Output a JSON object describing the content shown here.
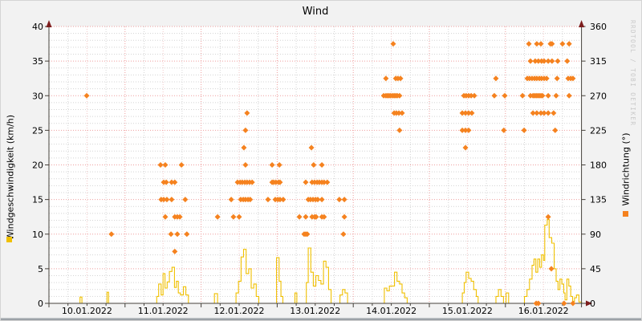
{
  "chart_data": {
    "type": "mixed",
    "title": "Wind",
    "watermark": "RRDTOOL / TOBI OETIKER",
    "x_axis": {
      "hours_total": 168,
      "minor_step_hours": 6,
      "major_step_hours": 24,
      "day_labels": [
        "10.01.2022",
        "11.01.2022",
        "12.01.2022",
        "13.01.2022",
        "14.01.2022",
        "15.01.2022",
        "16.01.2022"
      ]
    },
    "y_left": {
      "label": "Windgeschwindigkeit (km/h)",
      "min": 0,
      "max": 40,
      "tick_step": 5,
      "ticks": [
        0,
        5,
        10,
        15,
        20,
        25,
        30,
        35,
        40
      ]
    },
    "y_right": {
      "label": "Windrichtung (°)",
      "min": 0,
      "max": 360,
      "tick_step": 45,
      "ticks": [
        0,
        45,
        90,
        135,
        180,
        225,
        270,
        315,
        360
      ]
    },
    "grid": {
      "minor_h_step": 1,
      "minor_v_step_hours": 6,
      "legend_position": "axis-labels"
    },
    "colors": {
      "speed": "#f0c000",
      "direction": "#f5821f",
      "grid_minor": "#d4d4d4",
      "grid_major": "#ef9e9e",
      "grid_noon": "#f2c6c6",
      "axis": "#44403a",
      "arrow": "#7d1d1d",
      "plot_bg": "#ffffff",
      "outer_bg": "#f2f2f2"
    },
    "series": [
      {
        "name": "Windgeschwindigkeit",
        "unit": "km/h",
        "type": "step",
        "axis": "left",
        "color": "#f0c000",
        "points": [
          [
            0,
            0
          ],
          [
            9.8,
            0.9
          ],
          [
            10.4,
            0
          ],
          [
            18.3,
            1.6
          ],
          [
            18.8,
            0
          ],
          [
            34.0,
            1.0
          ],
          [
            34.6,
            2.8
          ],
          [
            35.4,
            1.2
          ],
          [
            36.0,
            4.3
          ],
          [
            36.6,
            2.2
          ],
          [
            37.3,
            3.1
          ],
          [
            38.0,
            4.6
          ],
          [
            38.8,
            5.2
          ],
          [
            39.6,
            2.3
          ],
          [
            40.2,
            3.2
          ],
          [
            40.8,
            1.5
          ],
          [
            41.5,
            1.2
          ],
          [
            42.4,
            2.4
          ],
          [
            43.2,
            1.2
          ],
          [
            44.0,
            0
          ],
          [
            52.2,
            1.4
          ],
          [
            53.2,
            0
          ],
          [
            59.0,
            1.5
          ],
          [
            59.8,
            3.2
          ],
          [
            60.6,
            6.7
          ],
          [
            61.4,
            7.8
          ],
          [
            62.2,
            4.3
          ],
          [
            63.0,
            5.0
          ],
          [
            63.8,
            2.2
          ],
          [
            64.6,
            2.8
          ],
          [
            65.4,
            1.0
          ],
          [
            66.2,
            0
          ],
          [
            71.8,
            6.6
          ],
          [
            72.6,
            3.2
          ],
          [
            73.2,
            1.0
          ],
          [
            73.8,
            0
          ],
          [
            77.6,
            1.5
          ],
          [
            78.2,
            0
          ],
          [
            81.2,
            3.0
          ],
          [
            81.8,
            8.0
          ],
          [
            82.6,
            4.5
          ],
          [
            83.4,
            2.5
          ],
          [
            84.2,
            4.0
          ],
          [
            85.0,
            3.3
          ],
          [
            85.8,
            2.8
          ],
          [
            86.6,
            6.1
          ],
          [
            87.4,
            5.2
          ],
          [
            88.2,
            2.0
          ],
          [
            89.0,
            0
          ],
          [
            91.8,
            1.2
          ],
          [
            92.6,
            2.0
          ],
          [
            93.4,
            1.5
          ],
          [
            94.2,
            0
          ],
          [
            105.8,
            2.2
          ],
          [
            106.6,
            1.8
          ],
          [
            107.4,
            2.5
          ],
          [
            109.0,
            4.5
          ],
          [
            109.8,
            3.2
          ],
          [
            110.6,
            2.8
          ],
          [
            111.4,
            1.5
          ],
          [
            112.2,
            0.8
          ],
          [
            113.0,
            0
          ],
          [
            130.4,
            1.5
          ],
          [
            131.0,
            3.0
          ],
          [
            131.6,
            4.5
          ],
          [
            132.4,
            3.6
          ],
          [
            133.2,
            3.2
          ],
          [
            134.0,
            2.0
          ],
          [
            134.8,
            1.0
          ],
          [
            135.4,
            0
          ],
          [
            141.0,
            1.0
          ],
          [
            141.8,
            2.0
          ],
          [
            142.6,
            1.0
          ],
          [
            143.4,
            0
          ],
          [
            144.2,
            1.5
          ],
          [
            145.0,
            0
          ],
          [
            150.0,
            1.0
          ],
          [
            150.8,
            2.0
          ],
          [
            151.6,
            3.5
          ],
          [
            152.4,
            5.5
          ],
          [
            153.0,
            6.4
          ],
          [
            153.6,
            4.5
          ],
          [
            154.2,
            6.4
          ],
          [
            154.8,
            5.2
          ],
          [
            155.4,
            7.0
          ],
          [
            156.0,
            6.2
          ],
          [
            156.4,
            11.3
          ],
          [
            157.2,
            12.1
          ],
          [
            157.8,
            9.5
          ],
          [
            158.6,
            8.7
          ],
          [
            159.4,
            5.0
          ],
          [
            160.0,
            3.2
          ],
          [
            160.6,
            2.0
          ],
          [
            161.2,
            3.5
          ],
          [
            161.8,
            2.8
          ],
          [
            162.4,
            1.5
          ],
          [
            162.8,
            0.5
          ],
          [
            163.4,
            3.5
          ],
          [
            164.0,
            2.5
          ],
          [
            164.6,
            1.0
          ],
          [
            165.2,
            0.3
          ],
          [
            165.8,
            0.8
          ],
          [
            166.4,
            1.2
          ],
          [
            167.2,
            0.2
          ],
          [
            168,
            0
          ]
        ]
      },
      {
        "name": "Windrichtung",
        "unit": "°",
        "type": "scatter",
        "marker": "diamond",
        "axis": "right",
        "color": "#f5821f",
        "points": [
          [
            11.9,
            270
          ],
          [
            19.7,
            90
          ],
          [
            35.2,
            180
          ],
          [
            35.4,
            135
          ],
          [
            36.2,
            157.5
          ],
          [
            36.2,
            135
          ],
          [
            36.7,
            180
          ],
          [
            36.7,
            112.5
          ],
          [
            37.0,
            157.5
          ],
          [
            37.2,
            135
          ],
          [
            38.5,
            90
          ],
          [
            38.7,
            157.5
          ],
          [
            38.7,
            135
          ],
          [
            39.7,
            157.5
          ],
          [
            39.7,
            112.5
          ],
          [
            39.7,
            67.5
          ],
          [
            40.5,
            112.5
          ],
          [
            40.5,
            90
          ],
          [
            41.3,
            112.5
          ],
          [
            41.8,
            180
          ],
          [
            43.0,
            135
          ],
          [
            43.5,
            90
          ],
          [
            53.2,
            112.5
          ],
          [
            57.5,
            135
          ],
          [
            58.2,
            112.5
          ],
          [
            59.5,
            157.5
          ],
          [
            60.0,
            112.5
          ],
          [
            60.3,
            157.5
          ],
          [
            60.5,
            135
          ],
          [
            61.0,
            157.5
          ],
          [
            61.3,
            135
          ],
          [
            61.5,
            202.5
          ],
          [
            61.8,
            157.5
          ],
          [
            62.0,
            225
          ],
          [
            62.0,
            180
          ],
          [
            62.0,
            135
          ],
          [
            62.5,
            247.5
          ],
          [
            62.5,
            157.5
          ],
          [
            62.8,
            135
          ],
          [
            63.3,
            157.5
          ],
          [
            63.5,
            135
          ],
          [
            64.1,
            157.5
          ],
          [
            69.1,
            135
          ],
          [
            70.4,
            180
          ],
          [
            70.4,
            157.5
          ],
          [
            70.9,
            157.5
          ],
          [
            71.4,
            135
          ],
          [
            71.6,
            157.5
          ],
          [
            72.2,
            135
          ],
          [
            72.4,
            157.5
          ],
          [
            72.7,
            180
          ],
          [
            72.9,
            157.5
          ],
          [
            72.9,
            135
          ],
          [
            73.9,
            135
          ],
          [
            79.0,
            112.5
          ],
          [
            80.5,
            90
          ],
          [
            81.0,
            90
          ],
          [
            81.0,
            157.5
          ],
          [
            81.0,
            112.5
          ],
          [
            81.5,
            90
          ],
          [
            81.8,
            135
          ],
          [
            82.5,
            135
          ],
          [
            82.8,
            202.5
          ],
          [
            83.0,
            157.5
          ],
          [
            83.0,
            112.5
          ],
          [
            83.3,
            135
          ],
          [
            83.5,
            180
          ],
          [
            83.8,
            157.5
          ],
          [
            83.8,
            112.5
          ],
          [
            84.1,
            135
          ],
          [
            84.3,
            112.5
          ],
          [
            84.6,
            157.5
          ],
          [
            84.8,
            135
          ],
          [
            85.3,
            157.5
          ],
          [
            86.1,
            180
          ],
          [
            86.1,
            157.5
          ],
          [
            86.1,
            135
          ],
          [
            86.1,
            112.5
          ],
          [
            86.8,
            157.5
          ],
          [
            86.8,
            112.5
          ],
          [
            87.8,
            157.5
          ],
          [
            91.6,
            135
          ],
          [
            92.9,
            90
          ],
          [
            93.2,
            135
          ],
          [
            93.2,
            112.5
          ],
          [
            105.6,
            270
          ],
          [
            106.3,
            292.5
          ],
          [
            106.3,
            270
          ],
          [
            106.8,
            270
          ],
          [
            107.3,
            270
          ],
          [
            107.8,
            270
          ],
          [
            108.4,
            270
          ],
          [
            108.6,
            337.5
          ],
          [
            108.9,
            270
          ],
          [
            108.9,
            247.5
          ],
          [
            109.4,
            292.5
          ],
          [
            109.4,
            270
          ],
          [
            109.6,
            247.5
          ],
          [
            109.9,
            270
          ],
          [
            110.1,
            292.5
          ],
          [
            110.4,
            247.5
          ],
          [
            110.6,
            270
          ],
          [
            110.6,
            225
          ],
          [
            110.9,
            292.5
          ],
          [
            111.4,
            247.5
          ],
          [
            130.4,
            247.5
          ],
          [
            130.4,
            225
          ],
          [
            130.9,
            270
          ],
          [
            131.4,
            247.5
          ],
          [
            131.4,
            225
          ],
          [
            131.4,
            202.5
          ],
          [
            131.6,
            270
          ],
          [
            132.4,
            270
          ],
          [
            132.4,
            247.5
          ],
          [
            132.4,
            225
          ],
          [
            133.2,
            270
          ],
          [
            133.4,
            247.5
          ],
          [
            134.2,
            270
          ],
          [
            140.5,
            270
          ],
          [
            141.0,
            292.5
          ],
          [
            143.5,
            225
          ],
          [
            143.8,
            270
          ],
          [
            149.4,
            270
          ],
          [
            149.9,
            225
          ],
          [
            150.9,
            292.5
          ],
          [
            151.4,
            337.5
          ],
          [
            151.6,
            292.5
          ],
          [
            151.9,
            315
          ],
          [
            151.9,
            270
          ],
          [
            152.4,
            292.5
          ],
          [
            152.7,
            270
          ],
          [
            152.7,
            247.5
          ],
          [
            153.2,
            292.5
          ],
          [
            153.2,
            270
          ],
          [
            153.4,
            315
          ],
          [
            153.7,
            270
          ],
          [
            153.7,
            0
          ],
          [
            153.9,
            337.5
          ],
          [
            153.9,
            292.5
          ],
          [
            153.9,
            247.5
          ],
          [
            154.2,
            270
          ],
          [
            154.4,
            315
          ],
          [
            154.4,
            0
          ],
          [
            154.7,
            292.5
          ],
          [
            154.7,
            270
          ],
          [
            155.2,
            337.5
          ],
          [
            155.2,
            270
          ],
          [
            155.2,
            247.5
          ],
          [
            155.4,
            315
          ],
          [
            155.4,
            292.5
          ],
          [
            155.7,
            270
          ],
          [
            156.2,
            315
          ],
          [
            156.2,
            292.5
          ],
          [
            156.2,
            247.5
          ],
          [
            157.0,
            292.5
          ],
          [
            157.5,
            315
          ],
          [
            157.5,
            270
          ],
          [
            157.5,
            247.5
          ],
          [
            157.5,
            112.5
          ],
          [
            158.2,
            337.5
          ],
          [
            158.5,
            45
          ],
          [
            158.7,
            337.5
          ],
          [
            158.7,
            315
          ],
          [
            159.2,
            247.5
          ],
          [
            159.7,
            225
          ],
          [
            160.0,
            270
          ],
          [
            160.3,
            292.5
          ],
          [
            160.5,
            315
          ],
          [
            162.0,
            337.5
          ],
          [
            162.5,
            0
          ],
          [
            163.5,
            315
          ],
          [
            163.8,
            292.5
          ],
          [
            164.1,
            337.5
          ],
          [
            164.1,
            270
          ],
          [
            164.6,
            292.5
          ],
          [
            165.3,
            292.5
          ],
          [
            165.3,
            0
          ]
        ]
      }
    ]
  }
}
